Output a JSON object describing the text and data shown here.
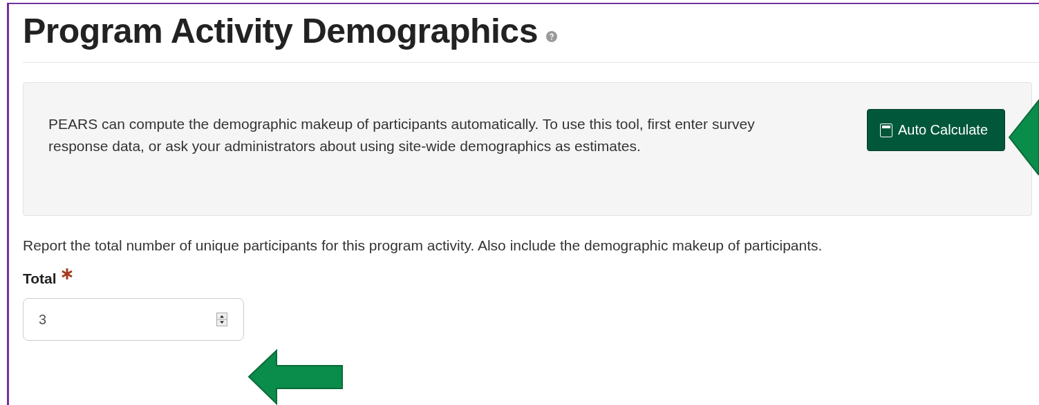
{
  "heading": {
    "title": "Program Activity Demographics"
  },
  "info_panel": {
    "text": "PEARS can compute the demographic makeup of participants automatically. To use this tool, first enter survey response data, or ask your administrators about using site-wide demographics as estimates.",
    "button": "Auto Calculate"
  },
  "instructions": "Report the total number of unique participants for this program activity. Also include the demographic makeup of participants.",
  "total_field": {
    "label": "Total",
    "required": true,
    "value": "3"
  }
}
